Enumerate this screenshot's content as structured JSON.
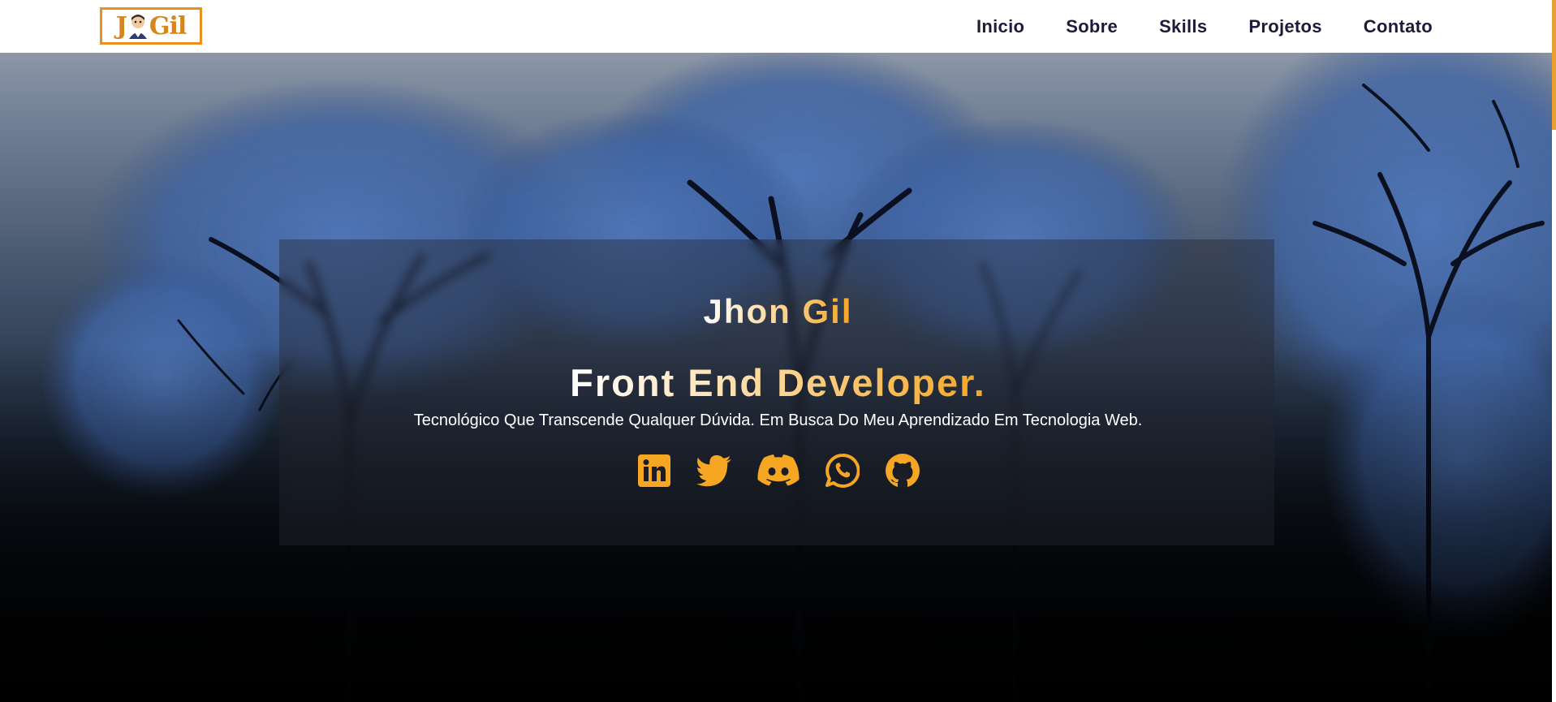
{
  "header": {
    "logo_text_left": "J",
    "logo_text_right": "Gil",
    "nav": [
      "Inicio",
      "Sobre",
      "Skills",
      "Projetos",
      "Contato"
    ]
  },
  "hero": {
    "name": "Jhon Gil",
    "role": "Front End Developer.",
    "description": "Tecnológico Que Transcende Qualquer Dúvida. Em Busca Do Meu Aprendizado Em Tecnologia Web.",
    "socials": [
      {
        "name": "linkedin",
        "icon": "linkedin-icon"
      },
      {
        "name": "twitter",
        "icon": "twitter-icon"
      },
      {
        "name": "discord",
        "icon": "discord-icon"
      },
      {
        "name": "whatsapp",
        "icon": "whatsapp-icon"
      },
      {
        "name": "github",
        "icon": "github-icon"
      }
    ]
  },
  "colors": {
    "accent": "#f5a623",
    "nav_text": "#1b1b3a",
    "logo_border": "#e8911f",
    "header_bg": "#ffffff"
  }
}
